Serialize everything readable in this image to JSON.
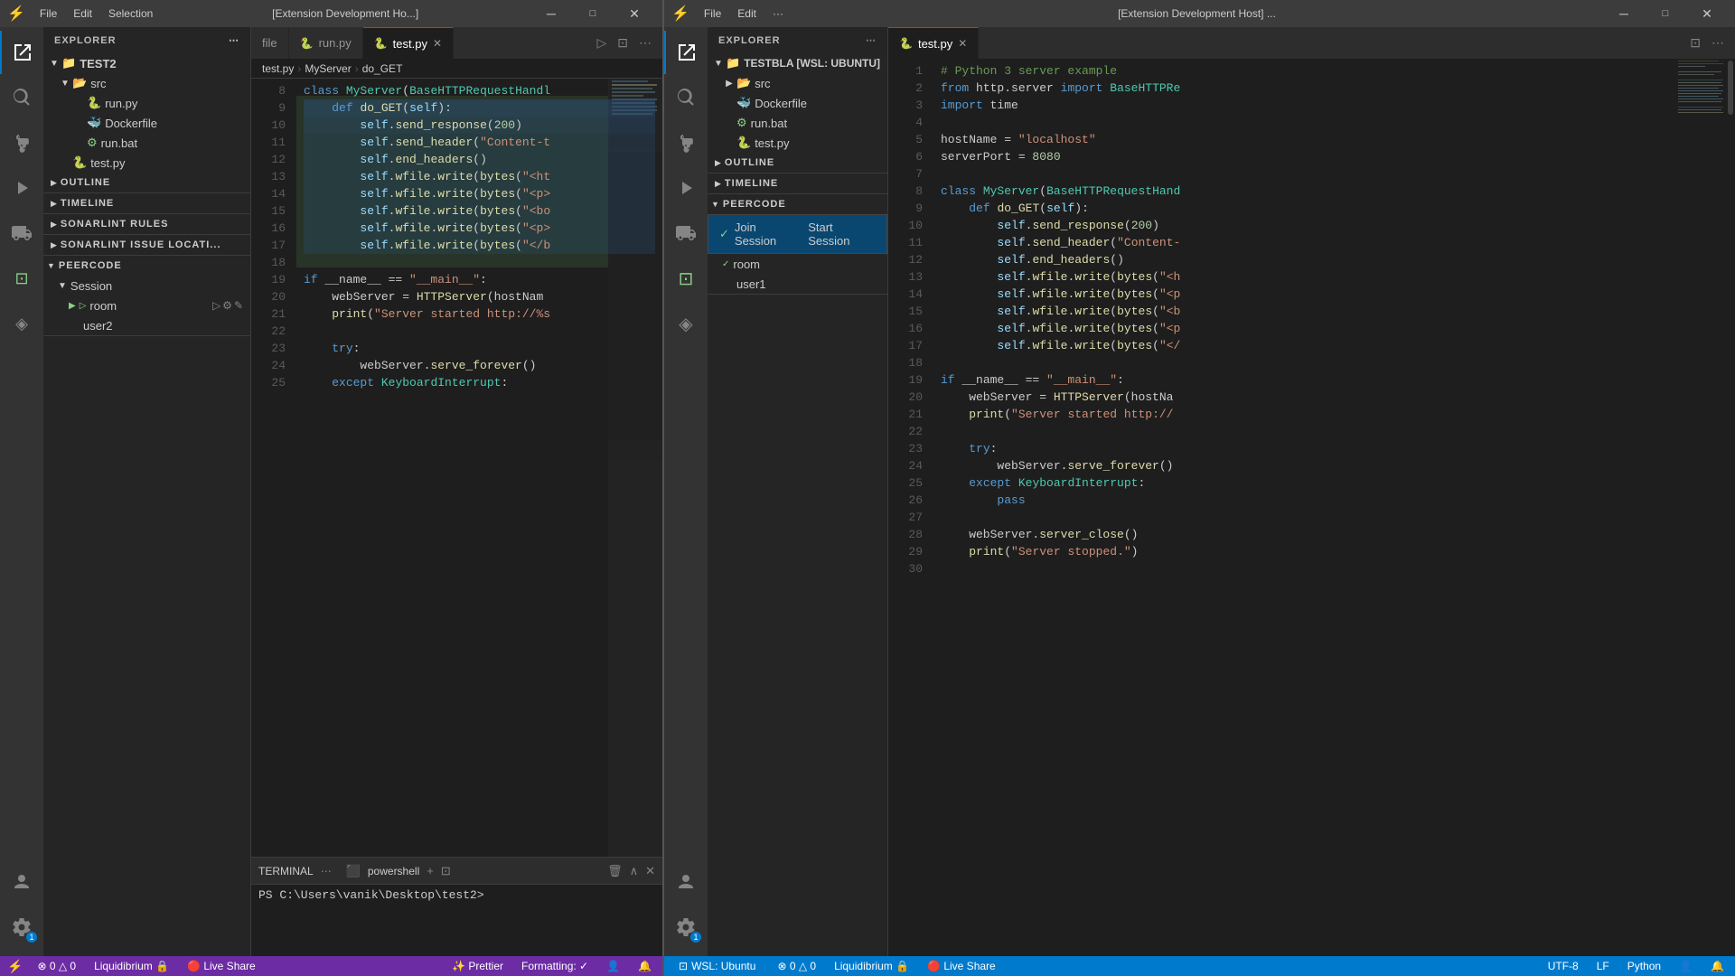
{
  "left_window": {
    "title_bar": {
      "icon": "⚡",
      "menu": [
        "File",
        "Edit",
        "Selection"
      ],
      "title": "[Extension Development Ho...]",
      "window_controls": [
        "─",
        "□",
        "✕"
      ]
    },
    "tabs": [
      {
        "label": "file",
        "active": false,
        "icon": ""
      },
      {
        "label": "run.py",
        "active": false,
        "icon": "🐍"
      },
      {
        "label": "test.py",
        "active": true,
        "icon": "🐍"
      }
    ],
    "breadcrumb": [
      "test.py",
      "MyServer",
      "do_GET"
    ],
    "code_lines": [
      {
        "num": 8,
        "content": "class MyServer(BaseHTTPRequestHandl"
      },
      {
        "num": 9,
        "content": "    def do_GET(self):"
      },
      {
        "num": 10,
        "content": "        self.send_response(200)"
      },
      {
        "num": 11,
        "content": "        self.send_header(\"Content-t"
      },
      {
        "num": 12,
        "content": "        self.end_headers()"
      },
      {
        "num": 13,
        "content": "        self.wfile.write(bytes(\"<ht"
      },
      {
        "num": 14,
        "content": "        self.wfile.write(bytes(\"<p>"
      },
      {
        "num": 15,
        "content": "        self.wfile.write(bytes(\"<bo"
      },
      {
        "num": 16,
        "content": "        self.wfile.write(bytes(\"<p>"
      },
      {
        "num": 17,
        "content": "        self.wfile.write(bytes(\"</b"
      },
      {
        "num": 18,
        "content": ""
      },
      {
        "num": 19,
        "content": "if __name__ == \"__main__\":"
      },
      {
        "num": 20,
        "content": "    webServer = HTTPServer(hostNam"
      },
      {
        "num": 21,
        "content": "    print(\"Server started http://%s"
      },
      {
        "num": 22,
        "content": ""
      },
      {
        "num": 23,
        "content": "    try:"
      },
      {
        "num": 24,
        "content": "        webServer.serve_forever()"
      },
      {
        "num": 25,
        "content": "        except KeyboardInterrupt:"
      }
    ],
    "sidebar": {
      "header": "EXPLORER",
      "root": "TEST2",
      "items": [
        {
          "label": "src",
          "type": "folder",
          "expanded": true,
          "indent": 1
        },
        {
          "label": "run.py",
          "type": "file-py",
          "indent": 2
        },
        {
          "label": "Dockerfile",
          "type": "file-docker",
          "indent": 2
        },
        {
          "label": "run.bat",
          "type": "file-bat",
          "indent": 2
        },
        {
          "label": "test.py",
          "type": "file-py",
          "indent": 2,
          "selected": true
        }
      ],
      "sections": [
        "OUTLINE",
        "TIMELINE",
        "SONARLINT RULES",
        "SONARLINT ISSUE LOCATI..."
      ],
      "peercode": {
        "label": "PEERCODE",
        "session": "Session",
        "room": "room",
        "user": "user2"
      }
    },
    "terminal": {
      "header": "TERMINAL",
      "shell": "powershell",
      "content": "PS C:\\Users\\vanik\\Desktop\\test2>"
    },
    "status_bar": {
      "left": [
        {
          "icon": "⚡",
          "label": "0",
          "sep": "△",
          "label2": "0"
        },
        {
          "label": "Liquidibrium 🔒"
        },
        {
          "icon": "🔴",
          "label": "Live Share"
        }
      ],
      "right": [
        {
          "label": "Prettier"
        },
        {
          "label": "Formatting: ✓"
        },
        {
          "icon": "👤",
          "label": ""
        },
        {
          "icon": "🔔",
          "label": ""
        }
      ]
    }
  },
  "right_window": {
    "title_bar": {
      "icon": "⚡",
      "menu": [
        "File",
        "Edit",
        "···"
      ],
      "title": "[Extension Development Host] ...",
      "window_controls": [
        "─",
        "□",
        "✕"
      ]
    },
    "tabs": [
      {
        "label": "test.py",
        "active": true,
        "icon": "🐍"
      }
    ],
    "breadcrumb": [],
    "sidebar": {
      "header": "EXPLORER",
      "root": "TESTBLA [WSL: UBUNTU]",
      "items": [
        {
          "label": "src",
          "type": "folder",
          "expanded": false,
          "indent": 1
        },
        {
          "label": "Dockerfile",
          "type": "file-docker",
          "indent": 1
        },
        {
          "label": "run.bat",
          "type": "file-bat",
          "indent": 1
        },
        {
          "label": "test.py",
          "type": "file-py",
          "indent": 1,
          "selected": false
        }
      ],
      "sections": [
        "OUTLINE",
        "TIMELINE"
      ],
      "peercode": {
        "label": "PEERCODE",
        "expanded": true,
        "dropdown": {
          "items": [
            {
              "label": "Join Session Start Session",
              "checked": true
            }
          ]
        },
        "session": "room",
        "user": "user1"
      }
    },
    "code_lines": [
      {
        "num": 1,
        "content": "    # Python 3 server example"
      },
      {
        "num": 2,
        "content": "from http.server import BaseHTTPRe"
      },
      {
        "num": 3,
        "content": "import time"
      },
      {
        "num": 4,
        "content": ""
      },
      {
        "num": 5,
        "content": "hostName = \"localhost\""
      },
      {
        "num": 6,
        "content": "serverPort = 8080"
      },
      {
        "num": 7,
        "content": ""
      },
      {
        "num": 8,
        "content": "class MyServer(BaseHTTPRequestHand"
      },
      {
        "num": 9,
        "content": "    def do_GET(self):"
      },
      {
        "num": 10,
        "content": "        self.send_response(200)"
      },
      {
        "num": 11,
        "content": "        self.send_header(\"Content-"
      },
      {
        "num": 12,
        "content": "        self.end_headers()"
      },
      {
        "num": 13,
        "content": "        self.wfile.write(bytes(\"<h"
      },
      {
        "num": 14,
        "content": "        self.wfile.write(bytes(\"<p"
      },
      {
        "num": 15,
        "content": "        self.wfile.write(bytes(\"<b"
      },
      {
        "num": 16,
        "content": "        self.wfile.write(bytes(\"<p"
      },
      {
        "num": 17,
        "content": "        self.wfile.write(bytes(\"</"
      },
      {
        "num": 18,
        "content": ""
      },
      {
        "num": 19,
        "content": "if __name__ == \"__main__\":"
      },
      {
        "num": 20,
        "content": "    webServer = HTTPServer(hostNa"
      },
      {
        "num": 21,
        "content": "    print(\"Server started http://"
      },
      {
        "num": 22,
        "content": ""
      },
      {
        "num": 23,
        "content": "    try:"
      },
      {
        "num": 24,
        "content": "        webServer.serve_forever()"
      },
      {
        "num": 25,
        "content": "        except KeyboardInterrupt:"
      },
      {
        "num": 26,
        "content": "            pass"
      },
      {
        "num": 27,
        "content": ""
      },
      {
        "num": 28,
        "content": "    webServer.server_close()"
      },
      {
        "num": 29,
        "content": "    print(\"Server stopped.\")"
      },
      {
        "num": 30,
        "content": ""
      }
    ],
    "status_bar": {
      "wsl_label": "WSL: Ubuntu",
      "left": [
        {
          "icon": "⚡",
          "label": "0",
          "sep": "△",
          "label2": "0"
        },
        {
          "label": "Liquidibrium 🔒"
        },
        {
          "icon": "🔴",
          "label": "Live Share"
        }
      ],
      "right": [
        {
          "label": "UTF-8"
        },
        {
          "label": "LF"
        },
        {
          "label": "Python"
        },
        {
          "icon": "🔔",
          "label": ""
        }
      ]
    }
  },
  "peercode_dropdown": {
    "label_join": "Join Session",
    "label_start": "Start Session",
    "room_label": "room",
    "user_label": "user1"
  },
  "activity_icons": {
    "explorer": "⎘",
    "search": "🔍",
    "source_control": "⎇",
    "run": "▷",
    "extensions": "⊞",
    "remote": "⊡",
    "peercode": "⬡",
    "account": "👤",
    "settings": "⚙"
  }
}
